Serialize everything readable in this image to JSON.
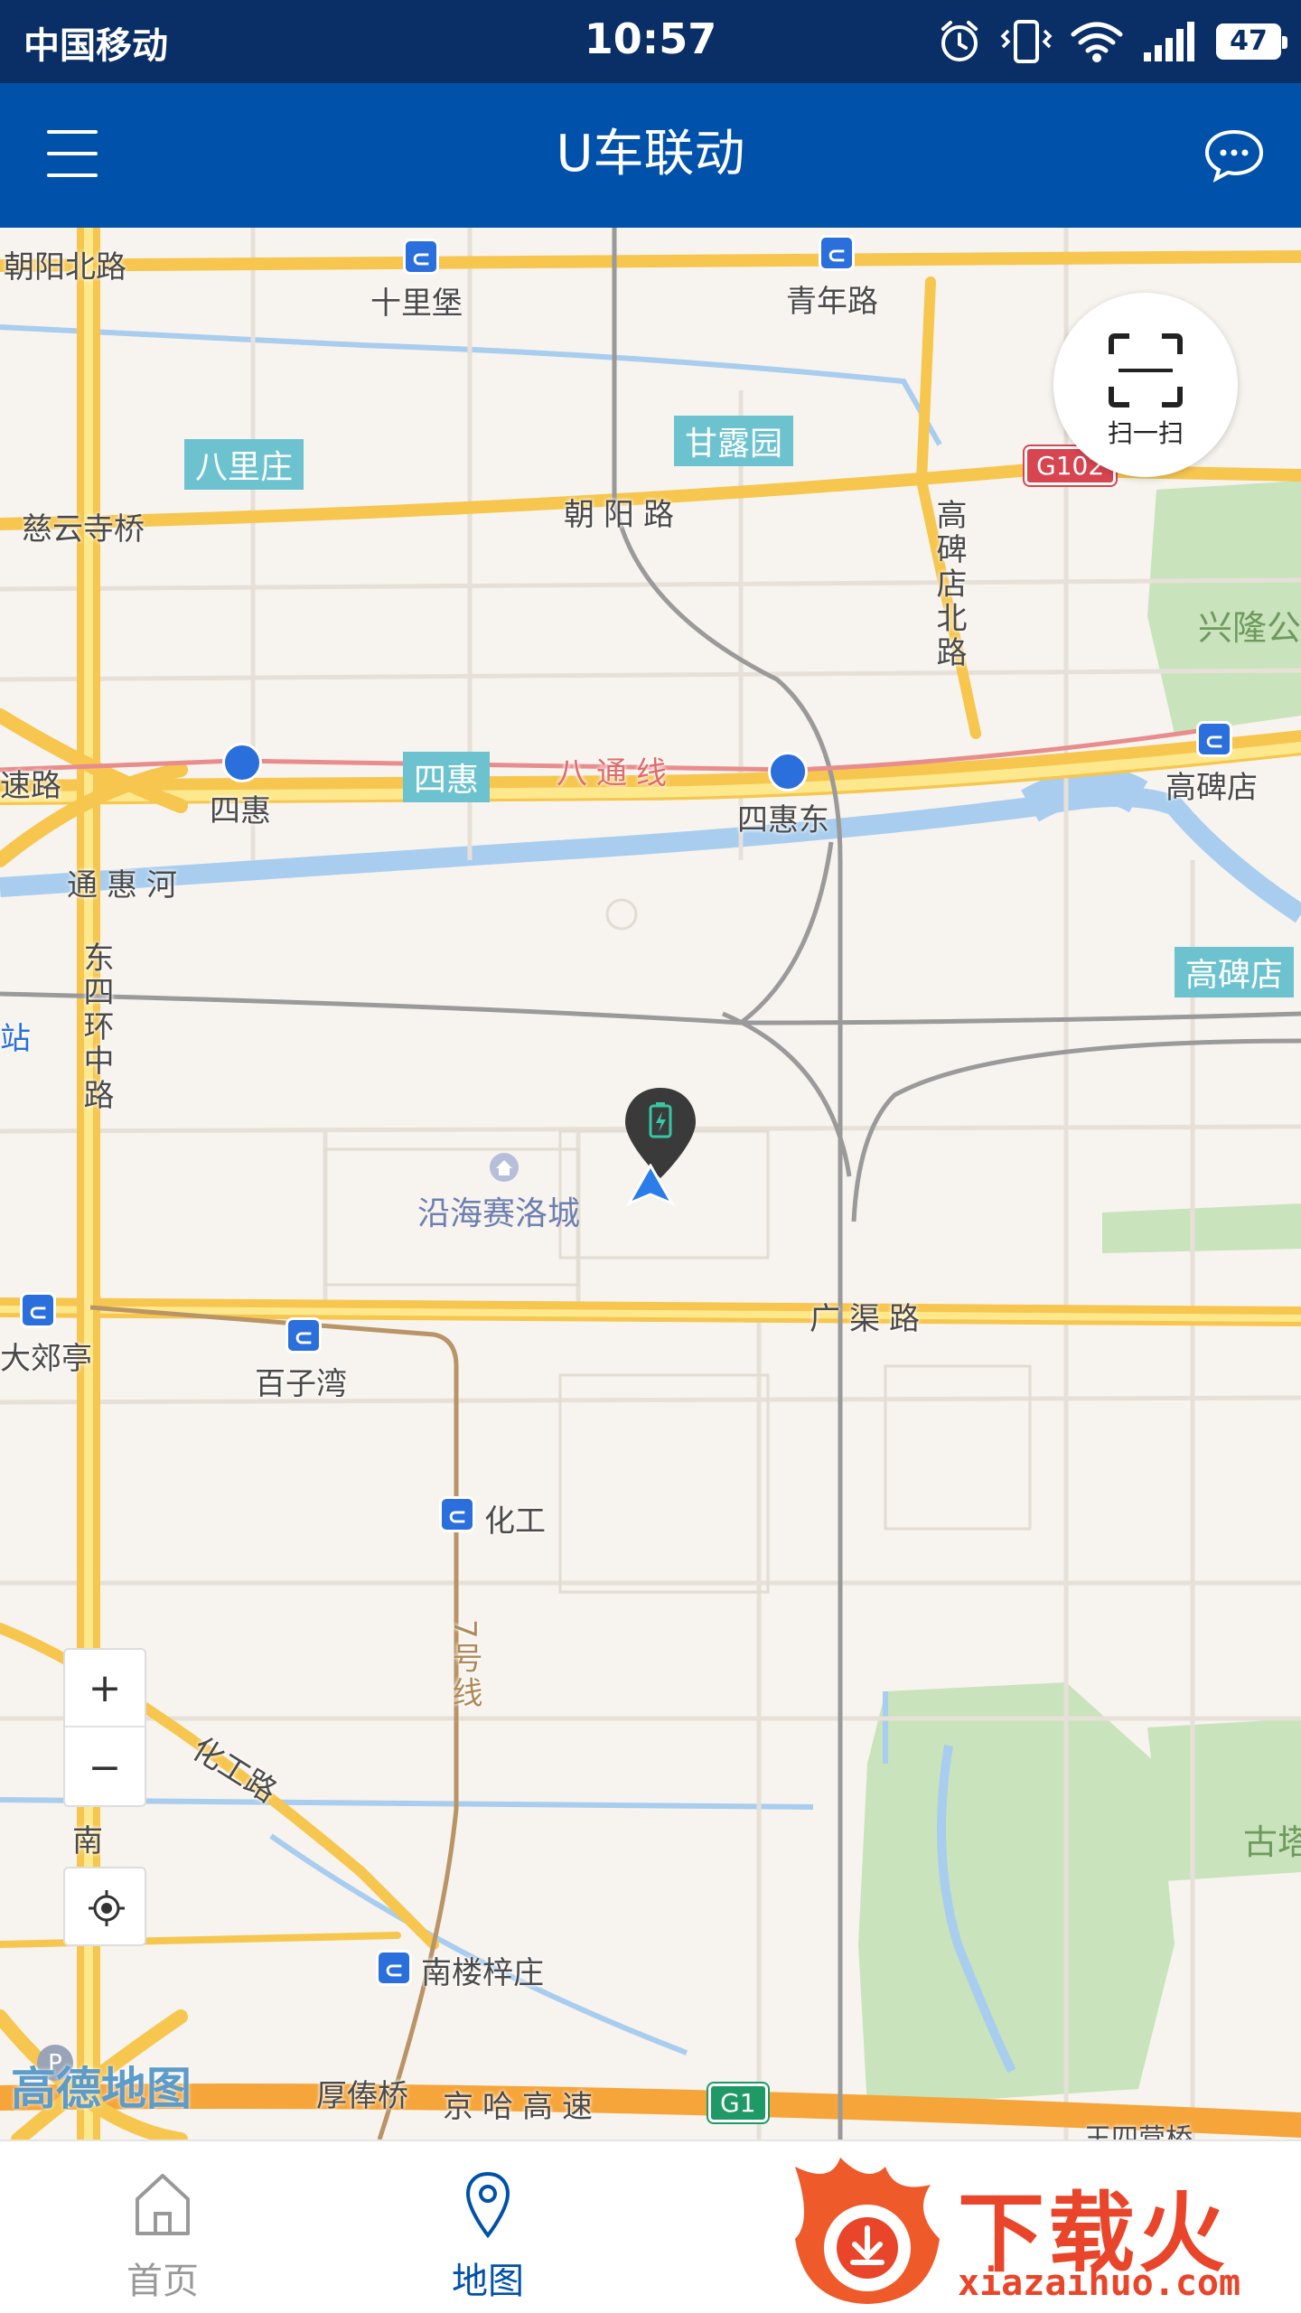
{
  "status_bar": {
    "carrier": "中国移动",
    "time": "10:57",
    "battery": "47"
  },
  "header": {
    "title": "U车联动"
  },
  "map": {
    "scan_label": "扫一扫",
    "zoom_in": "+",
    "zoom_out": "−",
    "roads": {
      "chaoyang_north": "朝阳北路",
      "chaoyang": "朝阳路",
      "ciyunsi": "慈云寺桥",
      "gaobeidian_north": "高碑店北路",
      "tonghui": "通惠河",
      "east4ring": "东四环中路",
      "guangqu": "广渠路",
      "huagong_road": "化工路",
      "jingha": "京哈高速",
      "houfeng": "厚俸桥",
      "su_road": "速路",
      "nan": "南",
      "zhan": "站",
      "wangsiying": "王四营桥"
    },
    "metro": {
      "shilipu": "十里堡",
      "qingnian": "青年路",
      "sihui": "四惠",
      "sihuidong": "四惠东",
      "gaobeidian": "高碑店",
      "dajiaoting": "大郊亭",
      "baiziwan": "百子湾",
      "huagong": "化工",
      "nanlouzizhuang": "南楼梓庄",
      "batong_line": "八通线",
      "line7": "7号线"
    },
    "areas": {
      "balizhuang": "八里庄",
      "ganluyuan": "甘露园",
      "sihui_area": "四惠",
      "gaobeidian_area": "高碑店"
    },
    "green": {
      "xinglong": "兴隆公",
      "gu": "古塔"
    },
    "poi": {
      "yanhai": "沿海赛洛城"
    },
    "shields": {
      "g102": "G102",
      "g1": "G1"
    },
    "logo": "高德地图"
  },
  "bottom_nav": {
    "home": "首页",
    "map": "地图"
  },
  "watermark": {
    "name": "下载火",
    "url": "xiazaihuo.com"
  }
}
